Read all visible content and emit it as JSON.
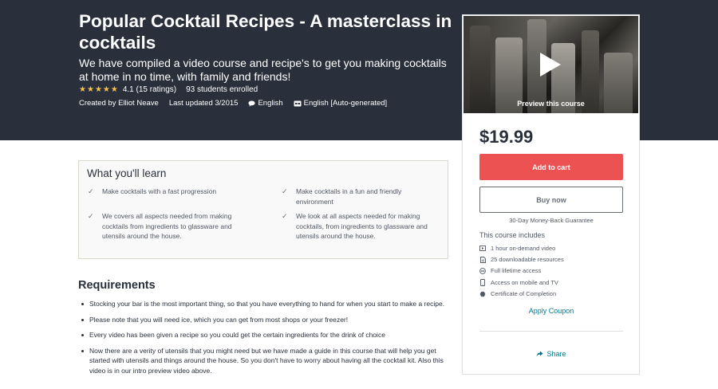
{
  "course": {
    "title": "Popular Cocktail Recipes - A masterclass in cocktails",
    "subtitle": "We have compiled a video course and recipe's to get you making cocktails at home in no time, with family and friends!",
    "rating_text": "4.1 (15 ratings)",
    "rating_value": 4.1,
    "students": "93 students enrolled",
    "created_by": "Created by Elliot Neave",
    "last_updated": "Last updated 3/2015",
    "language": "English",
    "captions": "English [Auto-generated]"
  },
  "sidebar": {
    "preview_label": "Preview this course",
    "price": "$19.99",
    "add_to_cart": "Add to cart",
    "buy_now": "Buy now",
    "guarantee": "30-Day Money-Back Guarantee",
    "includes_title": "This course includes",
    "includes": [
      {
        "icon": "video-icon",
        "text": "1 hour on-demand video"
      },
      {
        "icon": "file-icon",
        "text": "25 downloadable resources"
      },
      {
        "icon": "infinity-icon",
        "text": "Full lifetime access"
      },
      {
        "icon": "mobile-icon",
        "text": "Access on mobile and TV"
      },
      {
        "icon": "certificate-icon",
        "text": "Certificate of Completion"
      }
    ],
    "coupon": "Apply Coupon",
    "share": "Share"
  },
  "learn": {
    "title": "What you'll learn",
    "items": [
      "Make cocktails with a fast progression",
      "Make cocktails in a fun and friendly environment",
      "We covers all aspects needed from making cocktails from ingredients to glassware and utensils around the house.",
      "We look at all aspects needed for making cocktails, from ingredients to glassware and utensils around the house."
    ]
  },
  "requirements": {
    "title": "Requirements",
    "items": [
      "Stocking your bar is the most important thing, so that you have everything to hand for when you start to make a recipe.",
      "Please note that you will need ice, which you can get from most shops or your freezer!",
      "Every video has been given a recipe so you could get the certain ingredients for the drink of choice",
      "Now there are a verity of utensils that you might need but we have made a guide in this course that will help you get started with utensils and things around the house. So you don't have to worry about having all the cocktail kit. Also this video is in our intro preview video above."
    ]
  },
  "colors": {
    "header_bg": "#29303b",
    "cart_button": "#ec5252",
    "star": "#f4c150",
    "link": "#007791"
  }
}
